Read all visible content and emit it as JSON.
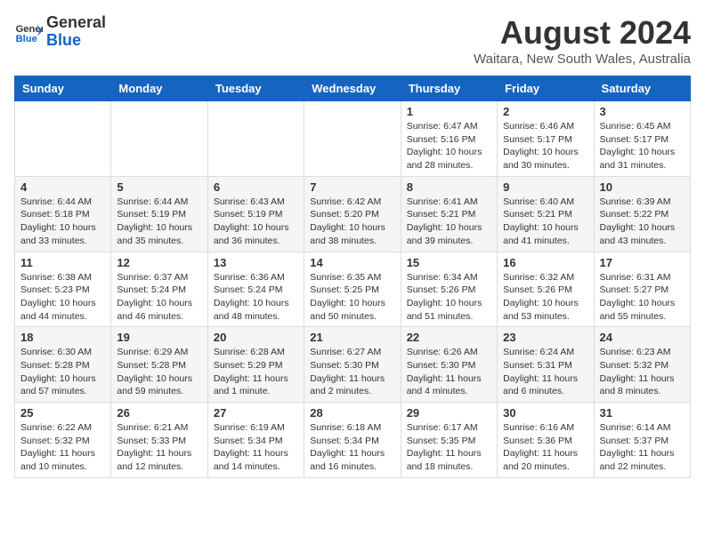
{
  "header": {
    "logo_general": "General",
    "logo_blue": "Blue",
    "month_year": "August 2024",
    "location": "Waitara, New South Wales, Australia"
  },
  "weekdays": [
    "Sunday",
    "Monday",
    "Tuesday",
    "Wednesday",
    "Thursday",
    "Friday",
    "Saturday"
  ],
  "weeks": [
    [
      {
        "day": "",
        "info": ""
      },
      {
        "day": "",
        "info": ""
      },
      {
        "day": "",
        "info": ""
      },
      {
        "day": "",
        "info": ""
      },
      {
        "day": "1",
        "info": "Sunrise: 6:47 AM\nSunset: 5:16 PM\nDaylight: 10 hours\nand 28 minutes."
      },
      {
        "day": "2",
        "info": "Sunrise: 6:46 AM\nSunset: 5:17 PM\nDaylight: 10 hours\nand 30 minutes."
      },
      {
        "day": "3",
        "info": "Sunrise: 6:45 AM\nSunset: 5:17 PM\nDaylight: 10 hours\nand 31 minutes."
      }
    ],
    [
      {
        "day": "4",
        "info": "Sunrise: 6:44 AM\nSunset: 5:18 PM\nDaylight: 10 hours\nand 33 minutes."
      },
      {
        "day": "5",
        "info": "Sunrise: 6:44 AM\nSunset: 5:19 PM\nDaylight: 10 hours\nand 35 minutes."
      },
      {
        "day": "6",
        "info": "Sunrise: 6:43 AM\nSunset: 5:19 PM\nDaylight: 10 hours\nand 36 minutes."
      },
      {
        "day": "7",
        "info": "Sunrise: 6:42 AM\nSunset: 5:20 PM\nDaylight: 10 hours\nand 38 minutes."
      },
      {
        "day": "8",
        "info": "Sunrise: 6:41 AM\nSunset: 5:21 PM\nDaylight: 10 hours\nand 39 minutes."
      },
      {
        "day": "9",
        "info": "Sunrise: 6:40 AM\nSunset: 5:21 PM\nDaylight: 10 hours\nand 41 minutes."
      },
      {
        "day": "10",
        "info": "Sunrise: 6:39 AM\nSunset: 5:22 PM\nDaylight: 10 hours\nand 43 minutes."
      }
    ],
    [
      {
        "day": "11",
        "info": "Sunrise: 6:38 AM\nSunset: 5:23 PM\nDaylight: 10 hours\nand 44 minutes."
      },
      {
        "day": "12",
        "info": "Sunrise: 6:37 AM\nSunset: 5:24 PM\nDaylight: 10 hours\nand 46 minutes."
      },
      {
        "day": "13",
        "info": "Sunrise: 6:36 AM\nSunset: 5:24 PM\nDaylight: 10 hours\nand 48 minutes."
      },
      {
        "day": "14",
        "info": "Sunrise: 6:35 AM\nSunset: 5:25 PM\nDaylight: 10 hours\nand 50 minutes."
      },
      {
        "day": "15",
        "info": "Sunrise: 6:34 AM\nSunset: 5:26 PM\nDaylight: 10 hours\nand 51 minutes."
      },
      {
        "day": "16",
        "info": "Sunrise: 6:32 AM\nSunset: 5:26 PM\nDaylight: 10 hours\nand 53 minutes."
      },
      {
        "day": "17",
        "info": "Sunrise: 6:31 AM\nSunset: 5:27 PM\nDaylight: 10 hours\nand 55 minutes."
      }
    ],
    [
      {
        "day": "18",
        "info": "Sunrise: 6:30 AM\nSunset: 5:28 PM\nDaylight: 10 hours\nand 57 minutes."
      },
      {
        "day": "19",
        "info": "Sunrise: 6:29 AM\nSunset: 5:28 PM\nDaylight: 10 hours\nand 59 minutes."
      },
      {
        "day": "20",
        "info": "Sunrise: 6:28 AM\nSunset: 5:29 PM\nDaylight: 11 hours\nand 1 minute."
      },
      {
        "day": "21",
        "info": "Sunrise: 6:27 AM\nSunset: 5:30 PM\nDaylight: 11 hours\nand 2 minutes."
      },
      {
        "day": "22",
        "info": "Sunrise: 6:26 AM\nSunset: 5:30 PM\nDaylight: 11 hours\nand 4 minutes."
      },
      {
        "day": "23",
        "info": "Sunrise: 6:24 AM\nSunset: 5:31 PM\nDaylight: 11 hours\nand 6 minutes."
      },
      {
        "day": "24",
        "info": "Sunrise: 6:23 AM\nSunset: 5:32 PM\nDaylight: 11 hours\nand 8 minutes."
      }
    ],
    [
      {
        "day": "25",
        "info": "Sunrise: 6:22 AM\nSunset: 5:32 PM\nDaylight: 11 hours\nand 10 minutes."
      },
      {
        "day": "26",
        "info": "Sunrise: 6:21 AM\nSunset: 5:33 PM\nDaylight: 11 hours\nand 12 minutes."
      },
      {
        "day": "27",
        "info": "Sunrise: 6:19 AM\nSunset: 5:34 PM\nDaylight: 11 hours\nand 14 minutes."
      },
      {
        "day": "28",
        "info": "Sunrise: 6:18 AM\nSunset: 5:34 PM\nDaylight: 11 hours\nand 16 minutes."
      },
      {
        "day": "29",
        "info": "Sunrise: 6:17 AM\nSunset: 5:35 PM\nDaylight: 11 hours\nand 18 minutes."
      },
      {
        "day": "30",
        "info": "Sunrise: 6:16 AM\nSunset: 5:36 PM\nDaylight: 11 hours\nand 20 minutes."
      },
      {
        "day": "31",
        "info": "Sunrise: 6:14 AM\nSunset: 5:37 PM\nDaylight: 11 hours\nand 22 minutes."
      }
    ]
  ]
}
